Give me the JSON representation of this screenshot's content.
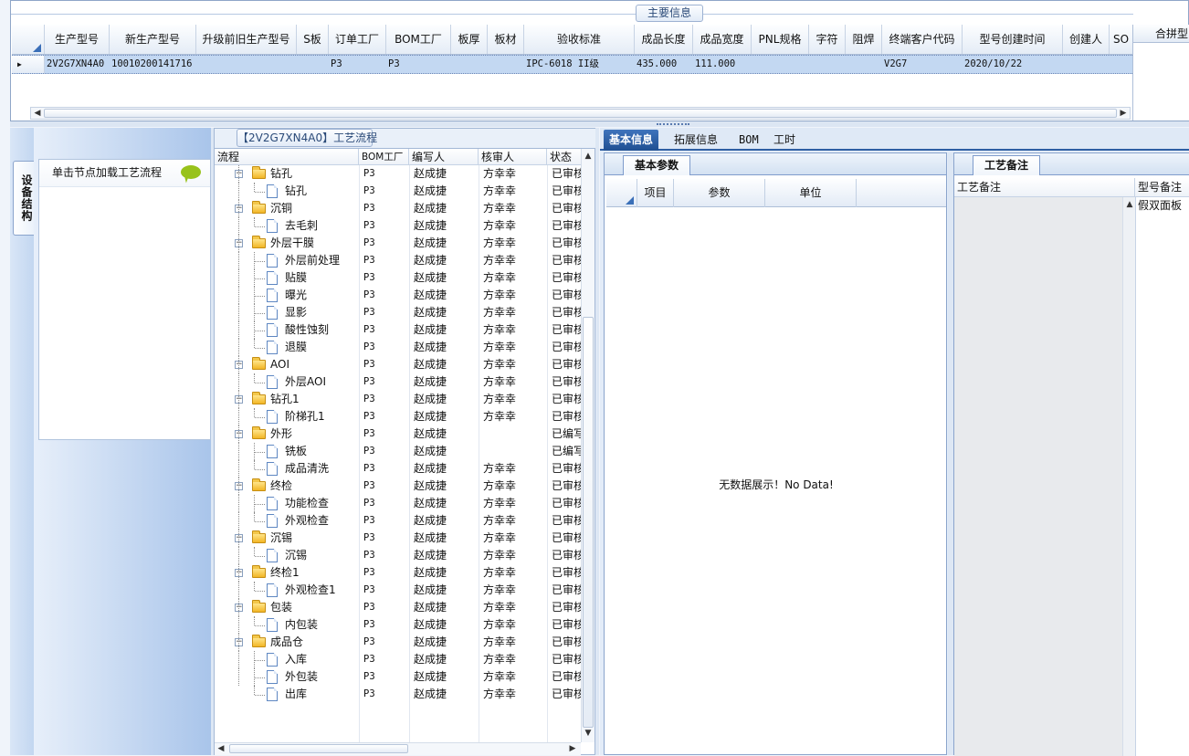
{
  "top": {
    "title": "主要信息",
    "columns": [
      "生产型号",
      "新生产型号",
      "升级前旧生产型号",
      "S板",
      "订单工厂",
      "BOM工厂",
      "板厚",
      "板材",
      "验收标准",
      "成品长度",
      "成品宽度",
      "PNL规格",
      "字符",
      "阻焊",
      "终端客户代码",
      "型号创建时间",
      "创建人",
      "SO"
    ],
    "row": {
      "prod_model": "2V2G7XN4A0",
      "new_prod_model": "10010200141716",
      "old_prod_model": "",
      "s_board": "",
      "order_factory": "P3",
      "bom_factory": "P3",
      "thickness": "",
      "material": "",
      "acceptance": "IPC-6018 II级",
      "length": "435.000",
      "width": "111.000",
      "pnl": "",
      "char": "",
      "mask": "",
      "customer_code": "V2G7",
      "created_time": "2020/10/22",
      "creator": "",
      "so": ""
    },
    "merge_header": "合拼型"
  },
  "left_strip": {
    "tab_label": "设备结构"
  },
  "node_panel": {
    "hint": "单击节点加载工艺流程"
  },
  "process": {
    "title": "【2V2G7XN4A0】工艺流程",
    "headers": {
      "flow": "流程",
      "bom": "BOM工厂",
      "writer": "编写人",
      "reviewer": "核审人",
      "status": "状态"
    },
    "rows": [
      {
        "name": "钻孔",
        "level": 0,
        "bom": "P3",
        "writer": "赵成捷",
        "reviewer": "方幸幸",
        "status": "已审核"
      },
      {
        "name": "钻孔",
        "level": 1,
        "bom": "P3",
        "writer": "赵成捷",
        "reviewer": "方幸幸",
        "status": "已审核"
      },
      {
        "name": "沉铜",
        "level": 0,
        "bom": "P3",
        "writer": "赵成捷",
        "reviewer": "方幸幸",
        "status": "已审核"
      },
      {
        "name": "去毛刺",
        "level": 1,
        "bom": "P3",
        "writer": "赵成捷",
        "reviewer": "方幸幸",
        "status": "已审核"
      },
      {
        "name": "外层干膜",
        "level": 0,
        "bom": "P3",
        "writer": "赵成捷",
        "reviewer": "方幸幸",
        "status": "已审核"
      },
      {
        "name": "外层前处理",
        "level": 1,
        "bom": "P3",
        "writer": "赵成捷",
        "reviewer": "方幸幸",
        "status": "已审核"
      },
      {
        "name": "贴膜",
        "level": 1,
        "bom": "P3",
        "writer": "赵成捷",
        "reviewer": "方幸幸",
        "status": "已审核"
      },
      {
        "name": "曝光",
        "level": 1,
        "bom": "P3",
        "writer": "赵成捷",
        "reviewer": "方幸幸",
        "status": "已审核"
      },
      {
        "name": "显影",
        "level": 1,
        "bom": "P3",
        "writer": "赵成捷",
        "reviewer": "方幸幸",
        "status": "已审核"
      },
      {
        "name": "酸性蚀刻",
        "level": 1,
        "bom": "P3",
        "writer": "赵成捷",
        "reviewer": "方幸幸",
        "status": "已审核"
      },
      {
        "name": "退膜",
        "level": 1,
        "bom": "P3",
        "writer": "赵成捷",
        "reviewer": "方幸幸",
        "status": "已审核"
      },
      {
        "name": "AOI",
        "level": 0,
        "bom": "P3",
        "writer": "赵成捷",
        "reviewer": "方幸幸",
        "status": "已审核"
      },
      {
        "name": "外层AOI",
        "level": 1,
        "bom": "P3",
        "writer": "赵成捷",
        "reviewer": "方幸幸",
        "status": "已审核"
      },
      {
        "name": "钻孔1",
        "level": 0,
        "bom": "P3",
        "writer": "赵成捷",
        "reviewer": "方幸幸",
        "status": "已审核"
      },
      {
        "name": "阶梯孔1",
        "level": 1,
        "bom": "P3",
        "writer": "赵成捷",
        "reviewer": "方幸幸",
        "status": "已审核"
      },
      {
        "name": "外形",
        "level": 0,
        "bom": "P3",
        "writer": "赵成捷",
        "reviewer": "",
        "status": "已编写"
      },
      {
        "name": "铣板",
        "level": 1,
        "bom": "P3",
        "writer": "赵成捷",
        "reviewer": "",
        "status": "已编写"
      },
      {
        "name": "成品清洗",
        "level": 1,
        "bom": "P3",
        "writer": "赵成捷",
        "reviewer": "方幸幸",
        "status": "已审核"
      },
      {
        "name": "终检",
        "level": 0,
        "bom": "P3",
        "writer": "赵成捷",
        "reviewer": "方幸幸",
        "status": "已审核"
      },
      {
        "name": "功能检查",
        "level": 1,
        "bom": "P3",
        "writer": "赵成捷",
        "reviewer": "方幸幸",
        "status": "已审核"
      },
      {
        "name": "外观检查",
        "level": 1,
        "bom": "P3",
        "writer": "赵成捷",
        "reviewer": "方幸幸",
        "status": "已审核"
      },
      {
        "name": "沉锡",
        "level": 0,
        "bom": "P3",
        "writer": "赵成捷",
        "reviewer": "方幸幸",
        "status": "已审核"
      },
      {
        "name": "沉锡",
        "level": 1,
        "bom": "P3",
        "writer": "赵成捷",
        "reviewer": "方幸幸",
        "status": "已审核"
      },
      {
        "name": "终检1",
        "level": 0,
        "bom": "P3",
        "writer": "赵成捷",
        "reviewer": "方幸幸",
        "status": "已审核"
      },
      {
        "name": "外观检查1",
        "level": 1,
        "bom": "P3",
        "writer": "赵成捷",
        "reviewer": "方幸幸",
        "status": "已审核"
      },
      {
        "name": "包装",
        "level": 0,
        "bom": "P3",
        "writer": "赵成捷",
        "reviewer": "方幸幸",
        "status": "已审核"
      },
      {
        "name": "内包装",
        "level": 1,
        "bom": "P3",
        "writer": "赵成捷",
        "reviewer": "方幸幸",
        "status": "已审核"
      },
      {
        "name": "成品仓",
        "level": 0,
        "bom": "P3",
        "writer": "赵成捷",
        "reviewer": "方幸幸",
        "status": "已审核"
      },
      {
        "name": "入库",
        "level": 1,
        "bom": "P3",
        "writer": "赵成捷",
        "reviewer": "方幸幸",
        "status": "已审核"
      },
      {
        "name": "外包装",
        "level": 1,
        "bom": "P3",
        "writer": "赵成捷",
        "reviewer": "方幸幸",
        "status": "已审核"
      },
      {
        "name": "出库",
        "level": 1,
        "bom": "P3",
        "writer": "赵成捷",
        "reviewer": "方幸幸",
        "status": "已审核"
      }
    ]
  },
  "info": {
    "tabs": [
      "基本信息",
      "拓展信息",
      "BOM",
      "工时"
    ],
    "params_tab": "基本参数",
    "params_columns": [
      "项目",
      "参数",
      "单位"
    ],
    "no_data": "无数据展示！No Data!",
    "notes_tab": "工艺备注",
    "notes_columns": [
      "工艺备注",
      "型号备注"
    ],
    "model_note": "假双面板"
  },
  "colors": {
    "accent": "#1f4f92",
    "selection": "#c3d8f2",
    "folder": "#f2b625"
  }
}
